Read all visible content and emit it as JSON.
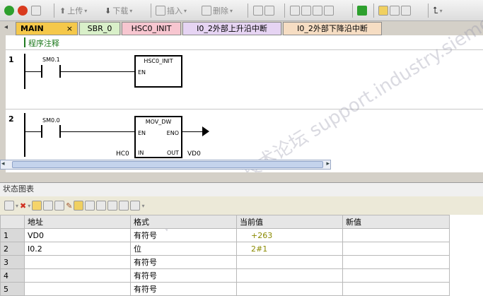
{
  "toolbar": {
    "upload_label": "上传",
    "download_label": "下载",
    "insert_label": "插入",
    "delete_label": "删除"
  },
  "tabs": [
    {
      "label": "MAIN",
      "active": true,
      "color": "#f5c84a"
    },
    {
      "label": "SBR_0",
      "active": false,
      "color": "#d9f0c9"
    },
    {
      "label": "HSC0_INIT",
      "active": false,
      "color": "#f7c6d0"
    },
    {
      "label": "I0_2外部上升沿中断",
      "active": false,
      "color": "#e6d4f3"
    },
    {
      "label": "I0_2外部下降沿中断",
      "active": false,
      "color": "#f6ddc3"
    }
  ],
  "tab_close": "×",
  "editor": {
    "comment": "程序注释",
    "networks": [
      {
        "number": "1",
        "contact": "SM0.1",
        "box_title": "HSC0_INIT",
        "pins": [
          "EN"
        ]
      },
      {
        "number": "2",
        "contact": "SM0.0",
        "box_title": "MOV_DW",
        "pins": [
          "EN",
          "ENO",
          "IN",
          "OUT"
        ],
        "in_value": "HC0",
        "out_value": "VD0"
      }
    ]
  },
  "watermark": "西门子工业 技术论坛 support.industry.siemens.com/cs",
  "status_chart": {
    "title": "状态图表",
    "columns": [
      "地址",
      "格式",
      "当前值",
      "新值"
    ],
    "rows": [
      {
        "n": "1",
        "addr": "VD0",
        "fmt": "有符号",
        "cur": "+263",
        "new": ""
      },
      {
        "n": "2",
        "addr": "I0.2",
        "fmt": "位",
        "cur": "2#1",
        "new": ""
      },
      {
        "n": "3",
        "addr": "",
        "fmt": "有符号",
        "cur": "",
        "new": ""
      },
      {
        "n": "4",
        "addr": "",
        "fmt": "有符号",
        "cur": "",
        "new": ""
      },
      {
        "n": "5",
        "addr": "",
        "fmt": "有符号",
        "cur": "",
        "new": ""
      }
    ]
  },
  "colors": {
    "accent": "#1f7a1f",
    "value_text": "#8a8a00"
  }
}
